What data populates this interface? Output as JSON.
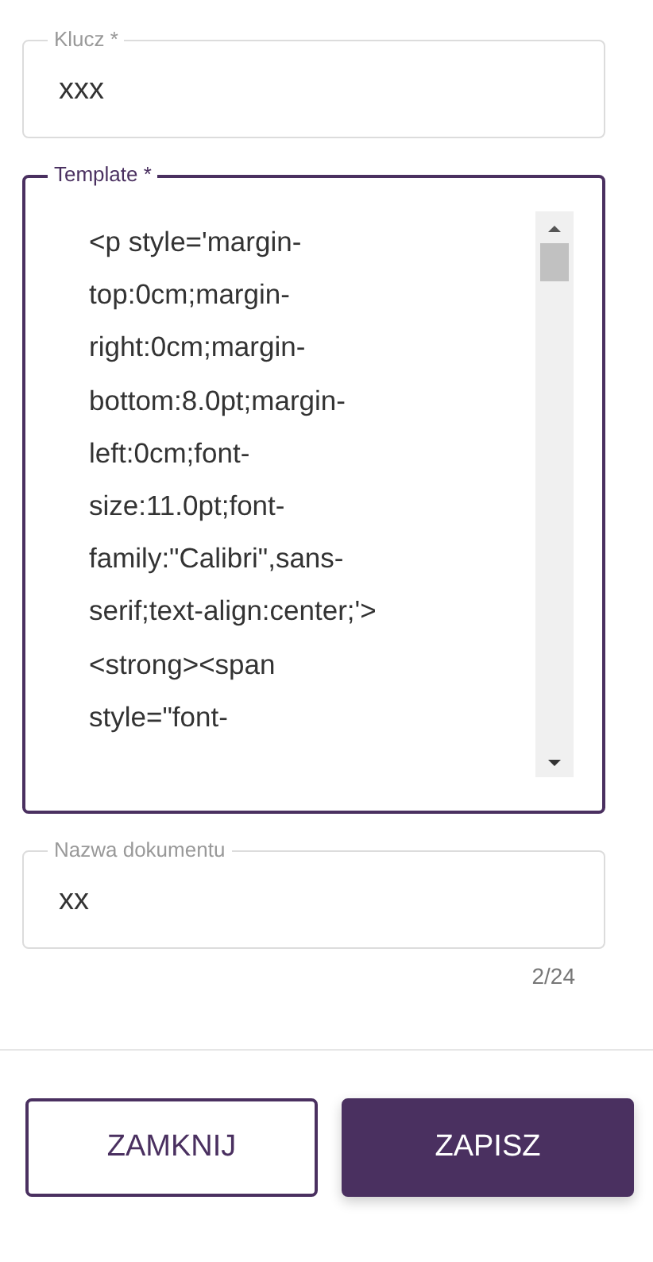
{
  "fields": [
    {
      "kind": "input",
      "label": "Klucz *",
      "value": "xxx",
      "focused": false
    },
    {
      "kind": "textarea",
      "label": "Template *",
      "value_lines": [
        "<p style='margin-",
        "top:0cm;margin-",
        "right:0cm;margin-",
        "bottom:8.0pt;margin-",
        "left:0cm;font-",
        "size:11.0pt;font-",
        "family:\"Calibri\",sans-",
        "serif;text-align:center;'>",
        "<strong><span",
        "style=\"font-"
      ],
      "focused": true
    },
    {
      "kind": "input",
      "label": "Nazwa dokumentu",
      "value": "xx",
      "focused": false,
      "counter": "2/24"
    }
  ],
  "buttons": [
    {
      "label": "ZAMKNIJ",
      "primary": false
    },
    {
      "label": "ZAPISZ",
      "primary": true
    }
  ]
}
